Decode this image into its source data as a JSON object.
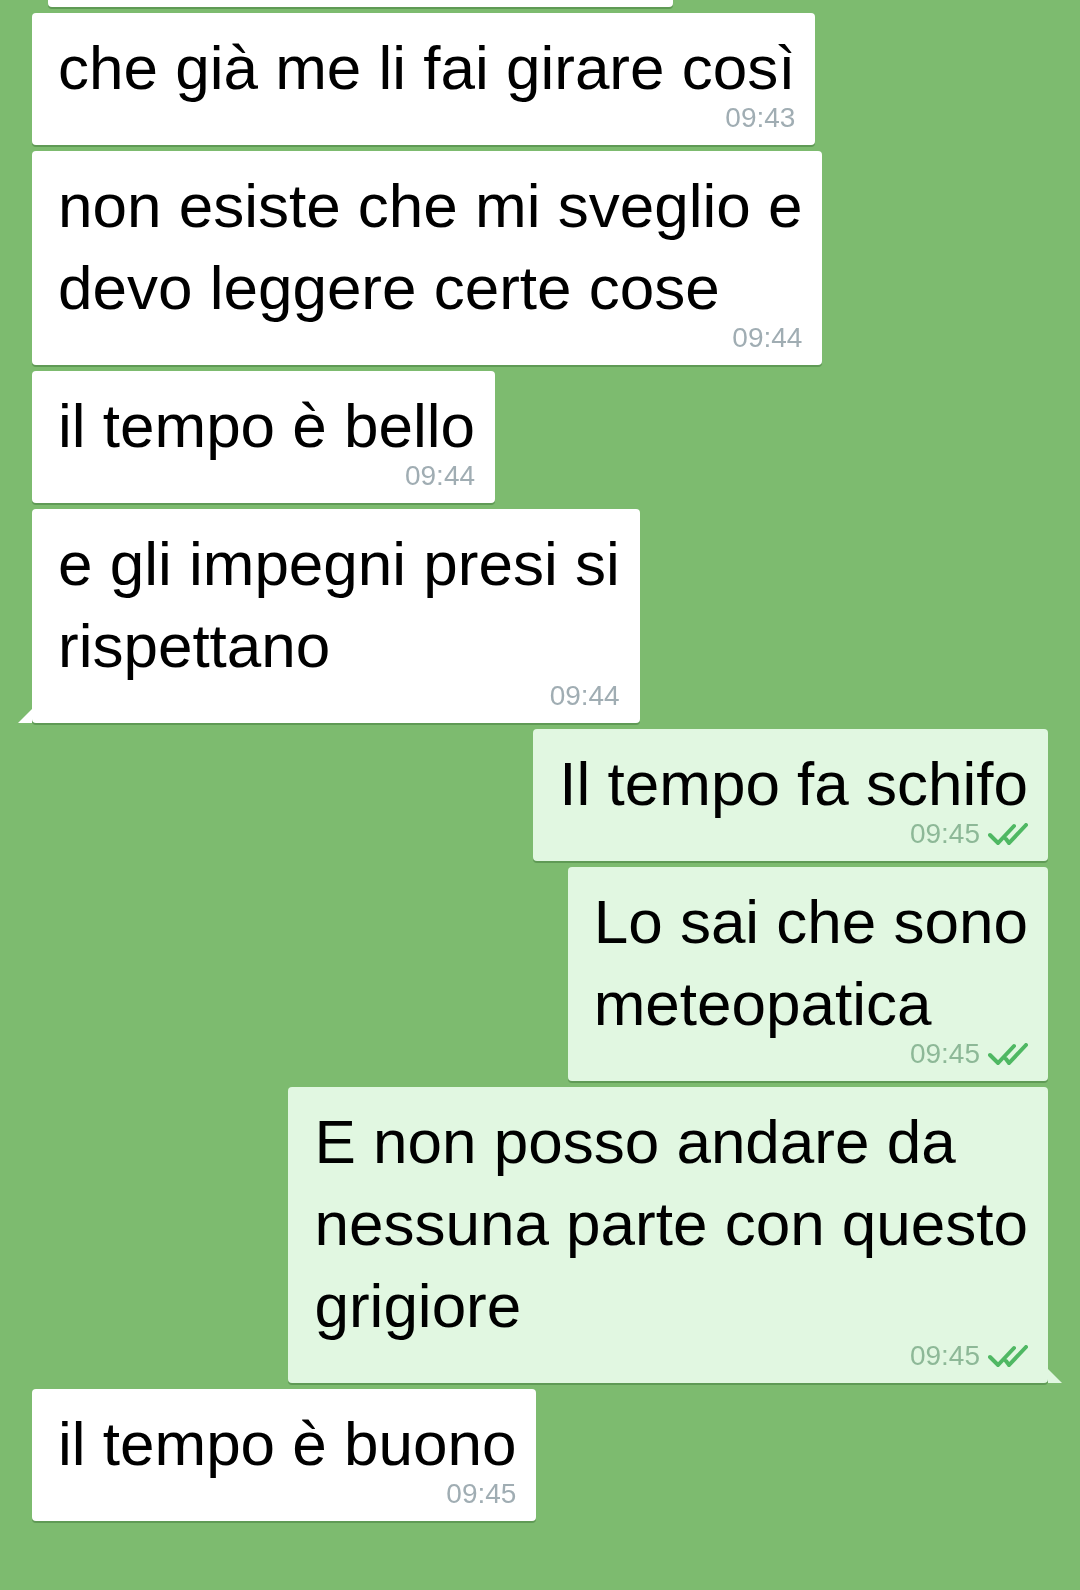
{
  "messages": [
    {
      "outgoing": false,
      "lines": [
        "che già me li fai girare così"
      ],
      "time": "09:43",
      "tail": false
    },
    {
      "outgoing": false,
      "lines": [
        "non esiste che mi sveglio e",
        "devo leggere certe cose"
      ],
      "time": "09:44",
      "tail": false
    },
    {
      "outgoing": false,
      "lines": [
        "il tempo è bello"
      ],
      "time": "09:44",
      "tail": false
    },
    {
      "outgoing": false,
      "lines": [
        "e gli impegni presi si",
        "rispettano"
      ],
      "time": "09:44",
      "tail": true
    },
    {
      "outgoing": true,
      "lines": [
        "Il tempo fa schifo"
      ],
      "time": "09:45",
      "read": true,
      "tail": false
    },
    {
      "outgoing": true,
      "lines": [
        "Lo sai che sono",
        "meteopatica"
      ],
      "time": "09:45",
      "read": true,
      "tail": false
    },
    {
      "outgoing": true,
      "lines": [
        "E non posso andare da",
        "nessuna parte con questo",
        "grigiore"
      ],
      "time": "09:45",
      "read": true,
      "tail": true
    },
    {
      "outgoing": false,
      "lines": [
        "il tempo è buono"
      ],
      "time": "09:45",
      "tail": false
    }
  ]
}
